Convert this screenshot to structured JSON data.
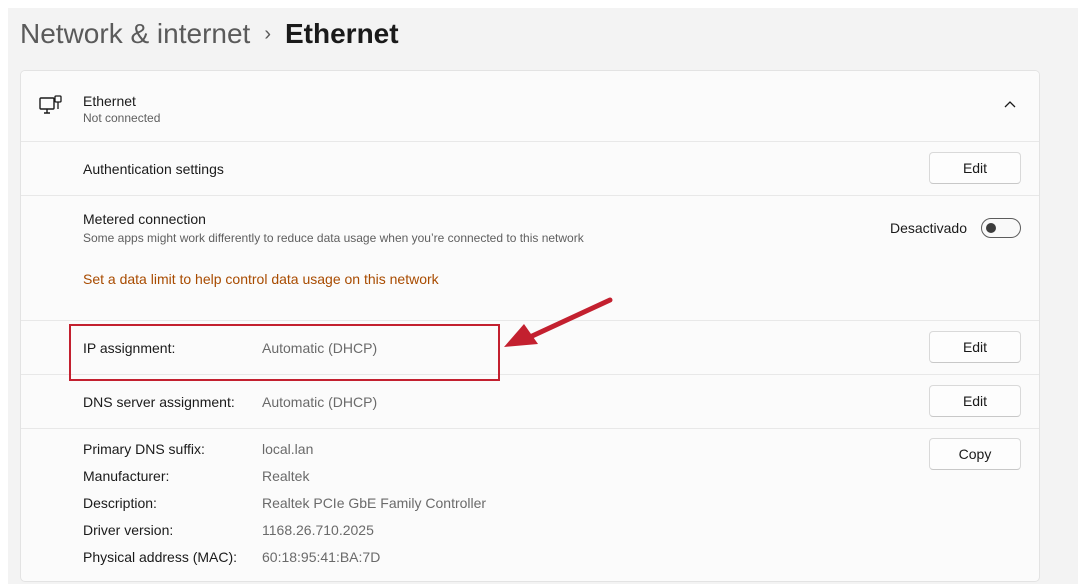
{
  "breadcrumb": {
    "parent": "Network & internet",
    "separator": "›",
    "current": "Ethernet"
  },
  "ethernet": {
    "title": "Ethernet",
    "status": "Not connected",
    "icon": "ethernet-monitor-icon",
    "collapse_icon": "chevron-up-icon"
  },
  "authentication": {
    "label": "Authentication settings",
    "button": "Edit"
  },
  "metered": {
    "label": "Metered connection",
    "description": "Some apps might work differently to reduce data usage when you’re connected to this network",
    "toggle_state": "Desactivado",
    "toggle_on": false,
    "link": "Set a data limit to help control data usage on this network"
  },
  "ip_assignment": {
    "label": "IP assignment:",
    "value": "Automatic (DHCP)",
    "button": "Edit"
  },
  "dns_assignment": {
    "label": "DNS server assignment:",
    "value": "Automatic (DHCP)",
    "button": "Edit"
  },
  "properties": {
    "copy_button": "Copy",
    "items": [
      {
        "label": "Primary DNS suffix:",
        "value": "local.lan"
      },
      {
        "label": "Manufacturer:",
        "value": "Realtek"
      },
      {
        "label": "Description:",
        "value": "Realtek PCIe GbE Family Controller"
      },
      {
        "label": "Driver version:",
        "value": "1168.26.710.2025"
      },
      {
        "label": "Physical address (MAC):",
        "value": "60:18:95:41:BA:7D"
      }
    ]
  },
  "colors": {
    "link": "#a84b00",
    "annotation": "#c3202f"
  }
}
